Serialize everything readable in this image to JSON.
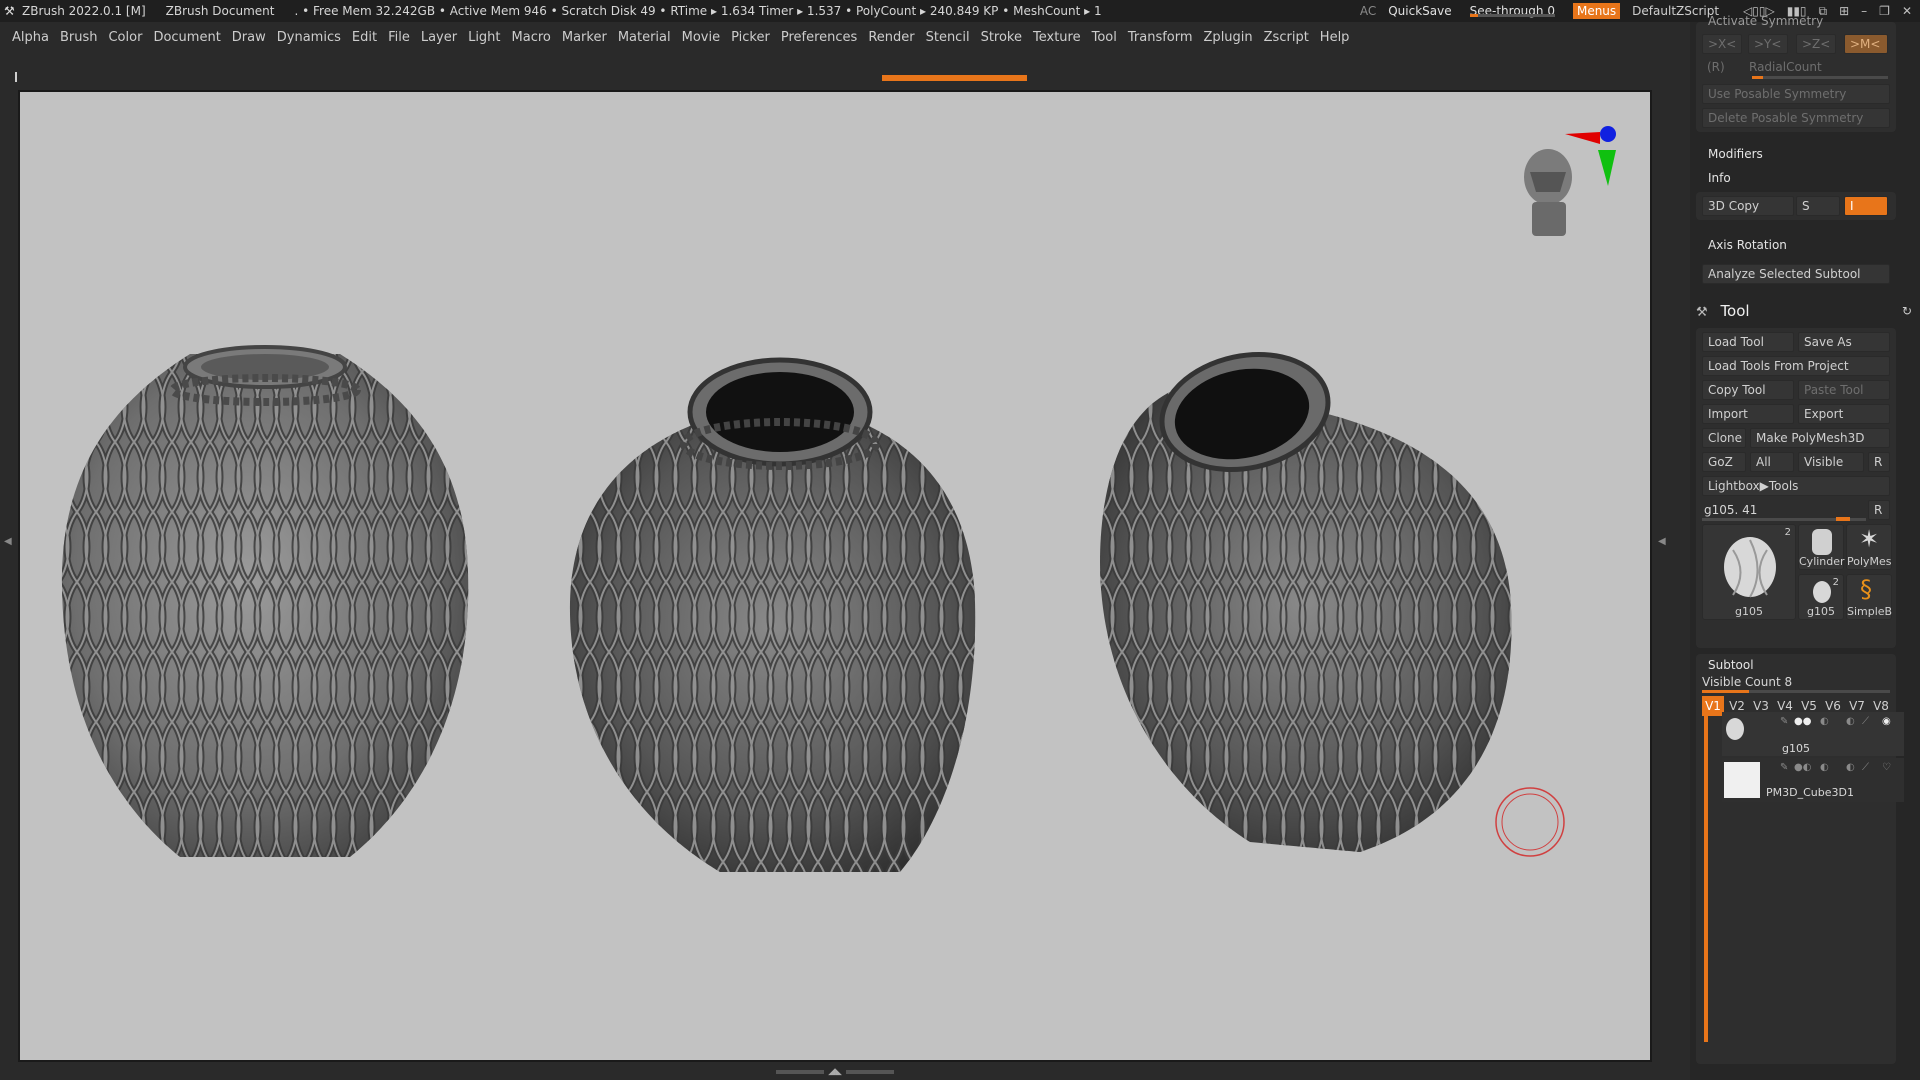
{
  "titlebar": {
    "app": "ZBrush 2022.0.1 [M]",
    "document": "ZBrush Document",
    "stats": ". • Free Mem 32.242GB • Active Mem 946 • Scratch Disk 49 •  RTime ▸ 1.634 Timer ▸ 1.537 • PolyCount ▸ 240.849 KP  • MeshCount ▸ 1",
    "ac": "AC",
    "quicksave": "QuickSave",
    "seethrough": "See-through",
    "seethrough_value": "0",
    "seethrough_fill": 0.1,
    "menus": "Menus",
    "script": "DefaultZScript",
    "icons": [
      "◁▯▯▷",
      "▮▮▯",
      "⧉",
      "⊞",
      "–",
      "❐",
      "✕"
    ]
  },
  "menu": [
    "Alpha",
    "Brush",
    "Color",
    "Document",
    "Draw",
    "Dynamics",
    "Edit",
    "File",
    "Layer",
    "Light",
    "Macro",
    "Marker",
    "Material",
    "Movie",
    "Picker",
    "Preferences",
    "Render",
    "Stencil",
    "Stroke",
    "Texture",
    "Tool",
    "Transform",
    "Zplugin",
    "Zscript",
    "Help"
  ],
  "colors": {
    "accent": "#e8751a",
    "viewport_bg": "#c2c2c2",
    "panel_bg": "#262626"
  },
  "panel": {
    "activate_symmetry": "Activate Symmetry",
    "sym_x": ">X<",
    "sym_y": ">Y<",
    "sym_z": ">Z<",
    "sym_m": ">M<",
    "sym_r": "(R)",
    "radial_count": "RadialCount",
    "use_posable": "Use Posable Symmetry",
    "delete_posable": "Delete Posable Symmetry",
    "modifiers": "Modifiers",
    "info": "Info",
    "copy3d": "3D Copy",
    "copy3d_s": "S",
    "copy3d_i": "I",
    "axis_rotation": "Axis Rotation",
    "analyze": "Analyze Selected Subtool"
  },
  "tool": {
    "title": "Tool",
    "load_tool": "Load Tool",
    "save_as": "Save As",
    "load_from_project": "Load Tools From Project",
    "copy_tool": "Copy Tool",
    "paste_tool": "Paste Tool",
    "import": "Import",
    "export": "Export",
    "clone": "Clone",
    "make_polymesh": "Make PolyMesh3D",
    "goz": "GoZ",
    "all": "All",
    "visible": "Visible",
    "r": "R",
    "lightbox": "Lightbox▶Tools",
    "current": "g105. 41",
    "current_r": "R",
    "thumbs": [
      {
        "label": "g105",
        "num": "2"
      },
      {
        "label": "Cylinder"
      },
      {
        "label": "PolyMes"
      },
      {
        "label": "g105",
        "num": "2"
      },
      {
        "label": "SimpleB"
      }
    ]
  },
  "subtool": {
    "title": "Subtool",
    "visible_count": "Visible Count 8",
    "visible_fill": 0.25,
    "tabs": [
      "V1",
      "V2",
      "V3",
      "V4",
      "V5",
      "V6",
      "V7",
      "V8"
    ],
    "active_tab": "V1",
    "items": [
      {
        "name": "g105"
      },
      {
        "name": "PM3D_Cube3D1"
      }
    ]
  }
}
